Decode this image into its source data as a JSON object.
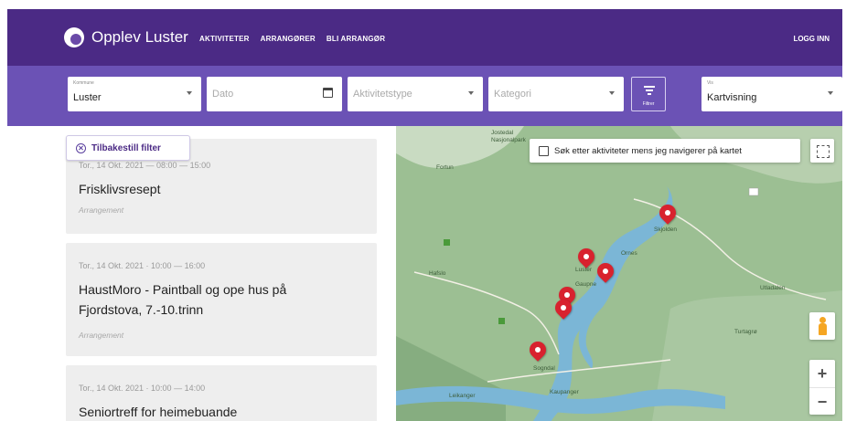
{
  "header": {
    "brand": "Opplev Luster",
    "nav": [
      "AKTIVITETER",
      "ARRANGØRER",
      "BLI ARRANGØR"
    ],
    "login": "LOGG INN"
  },
  "filters": {
    "municipality": {
      "label": "Kommune",
      "value": "Luster"
    },
    "date": {
      "placeholder": "Dato"
    },
    "activity_type": {
      "placeholder": "Aktivitetstype"
    },
    "category": {
      "placeholder": "Kategori"
    },
    "filter_button": "Filtrer",
    "view": {
      "label": "Vis",
      "value": "Kartvisning"
    }
  },
  "reset_filter": "Tilbakestill filter",
  "events": [
    {
      "date": "Tor., 14 Okt. 2021 — 08:00 — 15:00",
      "title": "Frisklivsresept",
      "type": "Arrangement"
    },
    {
      "date": "Tor., 14 Okt. 2021 · 10:00 — 16:00",
      "title": "HaustMoro - Paintball og ope hus på Fjordstova, 7.-10.trinn",
      "type": "Arrangement"
    },
    {
      "date": "Tor., 14 Okt. 2021 · 10:00 — 14:00",
      "title": "Seniortreff for heimebuande",
      "type": ""
    }
  ],
  "map": {
    "search_checkbox_label": "Søk etter aktiviteter mens jeg navigerer på kartet",
    "search_checkbox_checked": false,
    "zoom_in": "+",
    "zoom_out": "−",
    "labels": [
      "Jostedal",
      "Nasjonalpark",
      "Fortun",
      "Luster",
      "Gaupne",
      "Sogndal",
      "Kaupanger",
      "Leikanger",
      "Ornes",
      "Skjolden",
      "Utladalen",
      "Hafslo",
      "Turtagrø"
    ],
    "pin_color": "#d8222e"
  }
}
